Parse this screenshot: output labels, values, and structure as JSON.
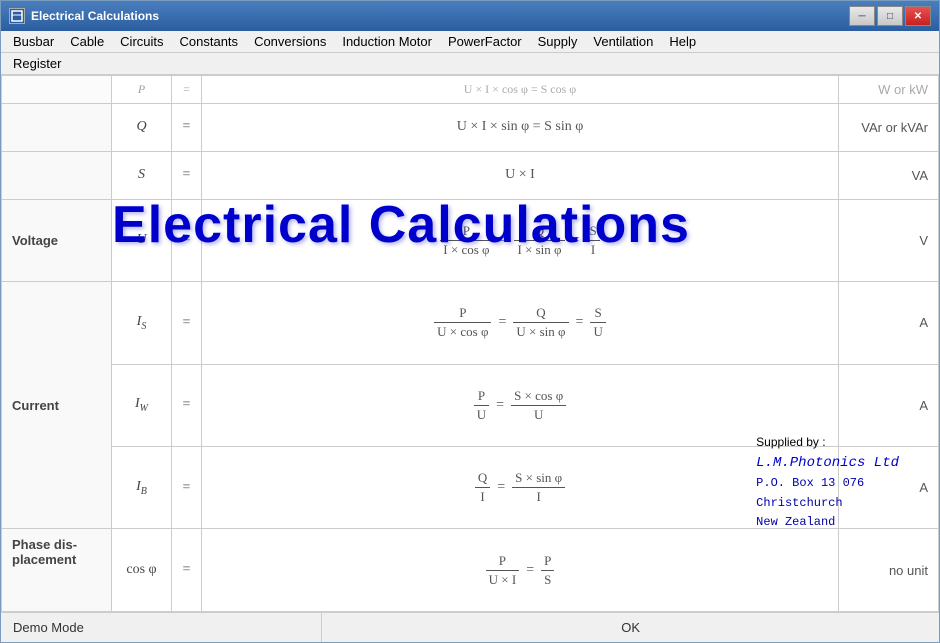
{
  "window": {
    "title": "Electrical Calculations",
    "icon": "⚡"
  },
  "titlebar": {
    "minimize_label": "─",
    "restore_label": "□",
    "close_label": "✕"
  },
  "menu": {
    "row1": [
      "Busbar",
      "Cable",
      "Circuits",
      "Constants",
      "Conversions",
      "Induction Motor",
      "PowerFactor",
      "Supply",
      "Ventilation",
      "Help"
    ],
    "row2": [
      "Register"
    ]
  },
  "big_title": "Electrical Calculations",
  "table": {
    "rows": [
      {
        "label": "",
        "symbol": "P",
        "eq": "=",
        "formula": "U × I × cos φ = S cos φ",
        "unit": "W or kW"
      },
      {
        "label": "",
        "symbol": "Q",
        "eq": "=",
        "formula": "U × I × sin φ = S sin φ",
        "unit": "VAr or kVAr"
      },
      {
        "label": "",
        "symbol": "S",
        "eq": "=",
        "formula": "U × I",
        "unit": "VA"
      },
      {
        "label": "Voltage",
        "symbol": "U",
        "eq": "=",
        "formula": "P/(I×cosφ) = Q/(I×sinφ) = S/I",
        "unit": "V"
      },
      {
        "label": "Current",
        "symbol": "IS",
        "eq": "=",
        "formula": "P/(U×cosφ) = Q/(U×sinφ) = S/U",
        "unit": "A"
      },
      {
        "label": "",
        "symbol": "IW",
        "eq": "=",
        "formula": "P/U = (S×cosφ)/U",
        "unit": "A"
      },
      {
        "label": "",
        "symbol": "IB",
        "eq": "=",
        "formula": "Q/I = (S×sinφ)/I",
        "unit": "A"
      },
      {
        "label": "Phase displacement",
        "symbol": "cos φ",
        "eq": "=",
        "formula": "P/(U×I) = P/S",
        "unit": "no unit"
      }
    ]
  },
  "supplier": {
    "line1": "Supplied by :",
    "line2": "L.M.Photonics Ltd",
    "line3": "P.O. Box 13 076",
    "line4": "Christchurch",
    "line5": "New Zealand"
  },
  "statusbar": {
    "left": "Demo Mode",
    "right": "OK"
  }
}
